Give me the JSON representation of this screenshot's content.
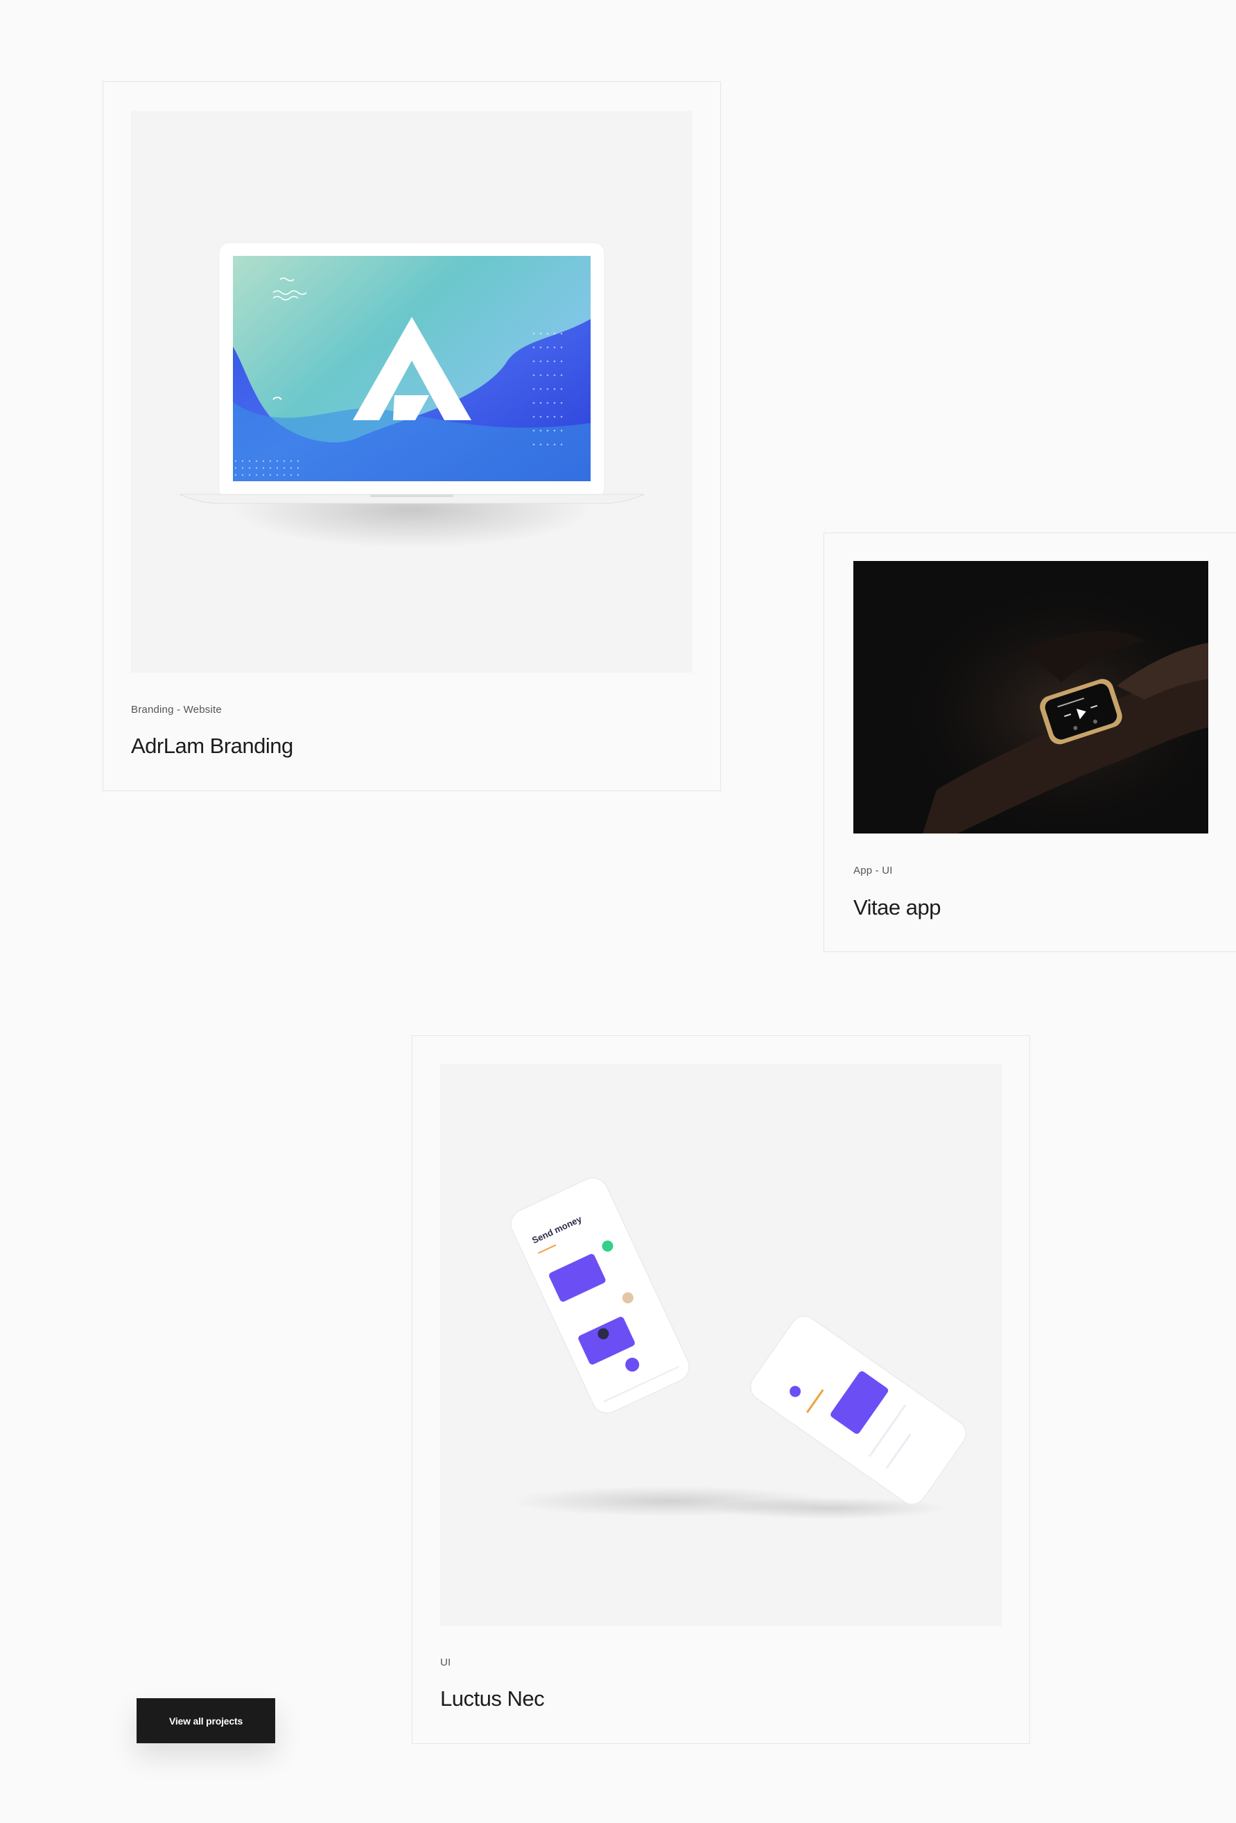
{
  "projects": [
    {
      "tags": "Branding - Website",
      "title": "AdrLam Branding",
      "image": "laptop-mockup-image"
    },
    {
      "tags": "App - UI",
      "title": "Vitae app",
      "image": "smartwatch-photo"
    },
    {
      "tags": "UI",
      "title": "Luctus Nec",
      "image": "phone-mockup-image"
    }
  ],
  "cta": {
    "label": "View all projects"
  },
  "colors": {
    "background": "#fafafa",
    "card_border": "#e6e6e6",
    "button": "#1b1b1b",
    "accent_purple": "#6c4ef5"
  }
}
